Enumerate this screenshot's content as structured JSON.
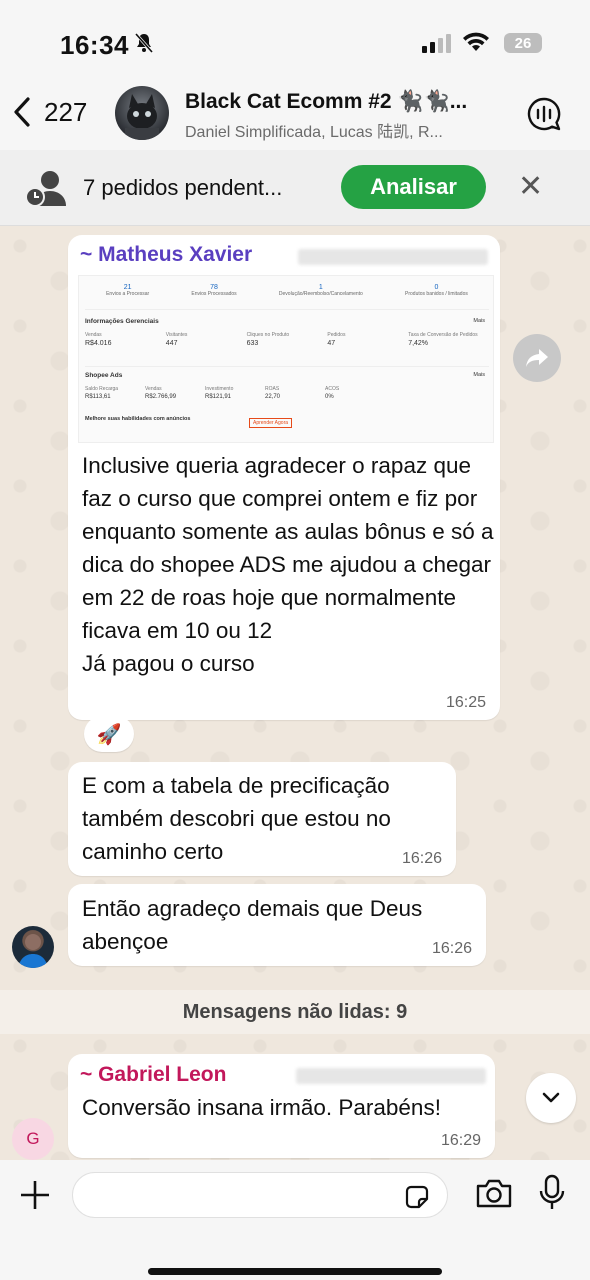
{
  "status": {
    "time": "16:34",
    "battery": "26"
  },
  "header": {
    "back_count": "227",
    "title": "Black Cat Ecomm #2 🐈‍⬛🐈‍⬛...",
    "subtitle": "Daniel Simplificada, Lucas 陆凯, R..."
  },
  "banner": {
    "text": "7 pedidos pendent...",
    "button": "Analisar"
  },
  "messages": {
    "m1": {
      "sender": "~ Matheus Xavier",
      "text": "Inclusive queria agradecer o rapaz que faz o curso que comprei ontem e fiz por enquanto somente as aulas bônus e só a dica do shopee ADS me ajudou a chegar em 22 de roas hoje que normalmente ficava em 10 ou 12\nJá pagou o curso",
      "time": "16:25",
      "reaction": "🚀",
      "screenshot": {
        "top_stats": [
          "21",
          "78",
          "1",
          "0"
        ],
        "top_labels": [
          "Envios a Processar",
          "Envios Processados",
          "Devolução/Reembolso/Cancelamento",
          "Produtos banidos / limitados"
        ],
        "section1": "Informações Gerenciais",
        "metrics1_labels": [
          "Vendas",
          "Visitantes",
          "Cliques no Produto",
          "Pedidos",
          "Taxa de Conversão de Pedidos"
        ],
        "metrics1_values": [
          "R$4.016",
          "447",
          "633",
          "47",
          "7,42%"
        ],
        "section2": "Shopee Ads",
        "metrics2_labels": [
          "Saldo Recarga",
          "Vendas",
          "Investimento",
          "ROAS",
          "ACOS"
        ],
        "metrics2_values": [
          "R$113,61",
          "R$2.766,99",
          "R$121,91",
          "22,70",
          "0%"
        ],
        "more": "Mais",
        "promo": "Melhore suas habilidades com anúncios",
        "promo_button": "Aprender Agora"
      }
    },
    "m2": {
      "text": "E com a tabela de precificação também descobri que estou no caminho certo",
      "time": "16:26"
    },
    "m3": {
      "text": "Então agradeço demais que Deus abençoe",
      "time": "16:26"
    },
    "unread": "Mensagens não lidas: 9",
    "m4": {
      "sender": "~ Gabriel Leon",
      "text": "Conversão insana irmão. Parabéns!",
      "time": "16:29",
      "avatar_letter": "G"
    }
  },
  "colors": {
    "matheus": "#5a3fc0",
    "gabriel": "#c2185b",
    "accent_green": "#25a244"
  }
}
